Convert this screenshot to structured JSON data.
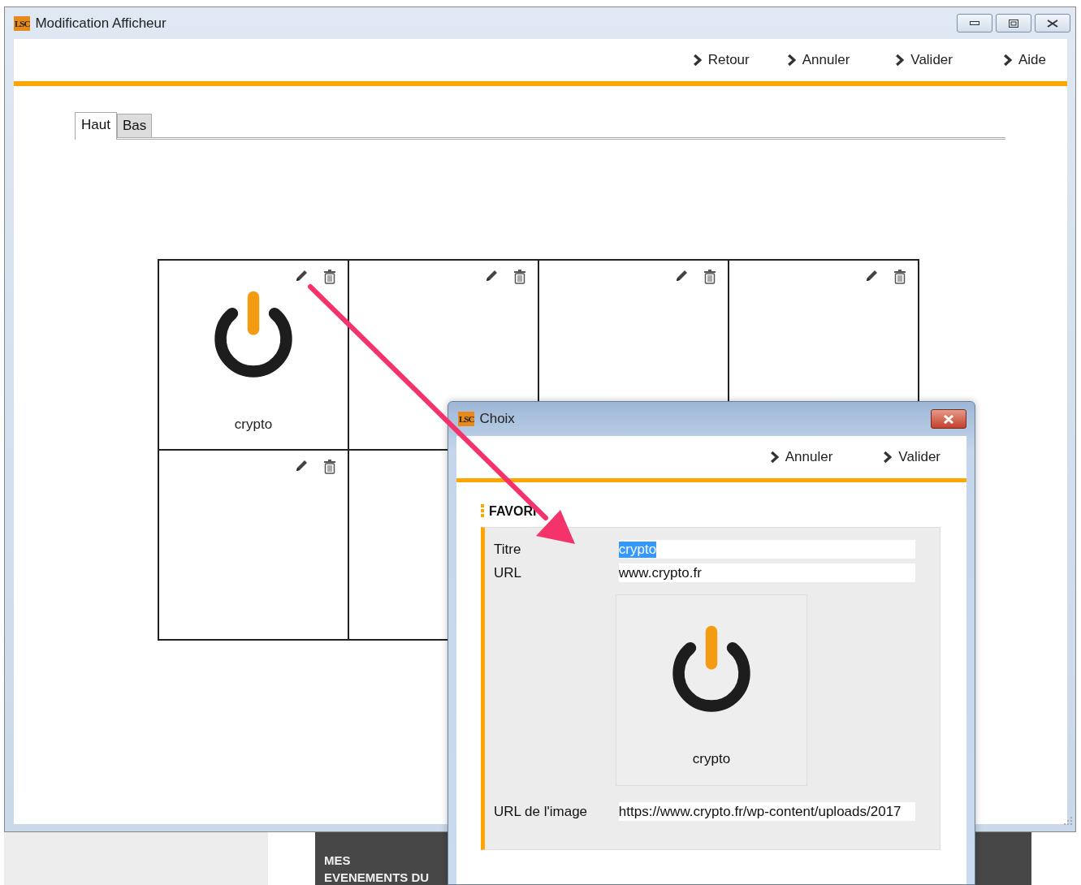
{
  "window": {
    "logo": "LSC",
    "title": "Modification Afficheur"
  },
  "toolbar": [
    "Retour",
    "Annuler",
    "Valider",
    "Aide"
  ],
  "tabs": [
    {
      "label": "Haut",
      "selected": true
    },
    {
      "label": "Bas",
      "selected": false
    }
  ],
  "tiles": [
    {
      "kind": "favorite",
      "label": "crypto"
    },
    {
      "kind": "empty"
    },
    {
      "kind": "empty"
    },
    {
      "kind": "empty"
    },
    {
      "kind": "empty"
    },
    {
      "kind": "covered"
    }
  ],
  "dialog": {
    "logo": "LSC",
    "title": "Choix",
    "toolbar": [
      "Annuler",
      "Valider"
    ],
    "section": "FAVORI",
    "fields": [
      {
        "label": "Titre",
        "value": "crypto",
        "selected": true
      },
      {
        "label": "URL",
        "value": "www.crypto.fr",
        "selected": false
      }
    ],
    "preview_label": "crypto",
    "image_url": {
      "label": "URL de l'image",
      "value": "https://www.crypto.fr/wp-content/uploads/2017"
    }
  },
  "background": {
    "banner": "MES EVENEMENTS DU"
  }
}
